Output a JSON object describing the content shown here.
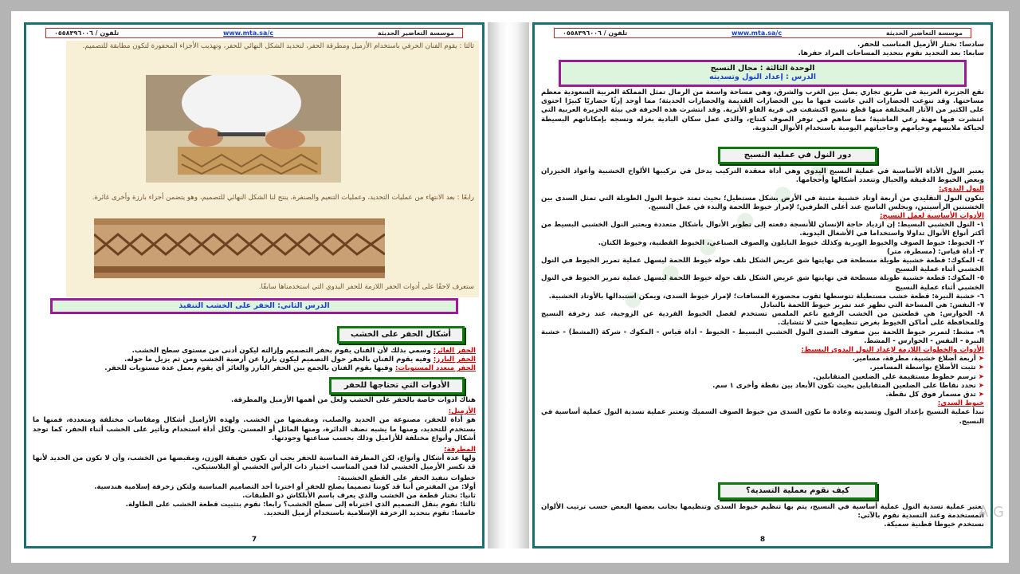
{
  "header": {
    "org": "موسسة التعاضير الحديثة",
    "url": "www.mta.sa/c",
    "phone": "تلفون / ٠٥٥٨٣٩٦٠٠٦"
  },
  "left_page": {
    "intro_1": "ثالثا : يقوم الفنان الحرفي باستخدام الأزميل ومطرقة الحفر، لتحديد الشكل النهائي للحفر، وتهذيب الأجزاء المحفورة لتكون مطابقة للتصميم.",
    "intro_2": "رابعًا : بعد الانتهاء من عمليات التحديد، وعمليات التنعيم والصنفرة، ينتج لنا الشكل النهائي للتصميم، وهو يتضمن أجزاء بارزة وأخرى غائرة.",
    "intro_3": "ستعرف لاحقًا على أدوات الحفر اللازمة للحفر اليدوي التي استخدمناها سابقًا.",
    "lesson_title": "الدرس الثاني: الحفر على الخشب التنفيذ",
    "shapes_title": "أشكال الحفر على الخشب",
    "shape_1_label": "الحفر الغائر:",
    "shape_1_text": "وسمي بذلك لأن الفنان يقوم بحفر التصميم وإزالته ليكون أدنى من مستوى سطح الخشب.",
    "shape_2_label": "الحفر البارز:",
    "shape_2_text": "وفيه يقوم الفنان بالحفر حول التصميم ليكون بارزا عن أرضية الخشب ومن ثم يزيل ما حوله.",
    "shape_3_label": "الحفر متعدد المستويات:",
    "shape_3_text": "وفيها يقوم الفنان بالجمع بين الحفر البارز والغائر أي يقوم بعمل عدة مستويات للحفر.",
    "tools_title": "الأدوات التي تحتاجها للحفر",
    "tools_intro": "هناك أدوات خاصة بالحفر على الخشب ولعل من أهمها الأزميل والمطرقة.",
    "chisel_label": "الأزميل:",
    "chisel_text": "هو أداة للحفر، مصنوعة من الحديد والصلب، ومقبضها من الخشب. ولهذه الأزاميل أشكال ومقاسات مختلفة ومتعددة، فمنها ما يستخدم للتحديد، ومنها ما يشبه نصف الدائرة، ومنها المائل أو المسنن. ولكل أداة استخدام وتأثير على الخشب أثناء الحفر، كما توجد أشكال وأنواع مختلفة للأزاميل وذلك بحسب صناعتها وجودتها.",
    "hammer_label": "المطرقة:",
    "hammer_text": "ولها عدة أشكال وأنواع، لكن المطرقة المناسبة للحفر يجب أن تكون خفيفة الوزن، ومقبضها من الخشب، وأن لا تكون من الحديد لأنها قد تكسر الأزميل الخشبي لذا فمن المناسب اختيار ذات الرأس الخشبي أو البلاستيكي.",
    "steps_title": "خطوات تنفيذ الحفر على القطع الخشبية:",
    "step_1": "أولا: من المفترض أننا قد كوننا تصميما يصلح للحفر أو اخترنا أحد التصاميم المناسبة ولتكن زخرفة إسلامية هندسية.",
    "step_2": "ثانيا: نختار قطعة من الخشب والذي يعرف باسم الأبلكاش ذو الطبقات.",
    "step_3": "ثالثا: نقوم بنقل التصميم الذي اخترناه إلى سطح الخشب؟ رابعا: نقوم بتثبيت قطعة الخشب على الطاولة.",
    "step_4": "خامسا: نقوم بتحديد الزخرفة الإسلامية باستخدام أزميل التحديد.",
    "page_number": "7"
  },
  "right_page": {
    "top_1": "سادسا: نختار الأزميل المناسب للحفر.",
    "top_2": "سابعا: بعد التحديد نقوم بتحديد المساحات المراد حفرها.",
    "unit_title": "الوحدة الثالثة : مجال النسيج",
    "lesson_title": "الدرس : إعداد النول وتسديته",
    "intro": "تقع الجزيرة العربية في طريق تجاري يصل بين الغرب والشرق، وهي مساحة واسعة من الرمال تمثل المملكة العربية السعودية معظم مساحتها. وقد تنوعت الحضارات التي عاشت فيها ما بين الحضارات القديمة والحضارات الحديثة؛ مما أوجد إرثًا حضاريًا كبيرًا احتوى على الكثير من الآثار المختلفة منها قطع نسيج اكتشفت في قرية الفاو الأثرية. وقد انتشرت هذه الحرفة في بيئة الجزيرة العربية التي انتشرت فيها مهنة رعي الماشية؛ مما ساهم في توفر الصوف كنتاج، والذي عمل سكان البادية بغزله ونسجه بإمكاناتهم البسيطة لحياكة ملابسهم وخيامهم وحاجياتهم اليومية باستخدام الأنوال البدوية.",
    "loom_role_title": "دور النول في عملية النسيج",
    "loom_role_text": "يعتبر النول الأداة الأساسية في عملية النسيج اليدوي وهي أداة معقدة التركيب يدخل في تركيبها الألواح الخشبية وأعواد الخيزران وبعض الخيوط الدقيقة والحبال وتتعدد أشكالها وأحجامها.",
    "bedouin_label": "النول البدوي:",
    "bedouin_text": "يتكون النول التقليدي من أربعة أوتاد خشبية مثبتة في الأرض بشكل مستطيل؛ بحيث تمتد خيوط النول الطويلة التي تمثل السدى بين الخشبتين الرأسيتين، ويجلس الناسج عند أعلى الطرفين؛ لإمرار خيوط اللحمة والبدء في عمل النسيج.",
    "basic_tools_label": "الأدوات الأساسية لعمل النسيج:",
    "tool_1": "١- النول الخشبي البسيط: إن ازدياد حاجة الإنسان للأنسجة دفعته إلى تطوير الأنوال بأشكال متعددة ويعتبر النول الخشبي البسيط من أكثر أنواع الأنوال تداولا واستخداما في الأشغال اليدوية.",
    "tool_2": "٢- الخيوط: خيوط الصوف والخيوط الوبرية وكذلك خيوط النايلون والصوف الصناعي، الخيوط القطنية، وخيوط الكتان.",
    "tool_3": "٣- أداة قياس: (مسطرة، متر)",
    "tool_4": "٤- المكوك: قطعة خشبية طويلة مسطحة في نهايتها شق عريض الشكل تلف حوله خيوط اللحمة ليسهل عملية تمرير الخيوط في النول الخشبي أثناء عملية النسيج",
    "tool_5": "٥- المكوك: قطعة خشبية طويلة مسطحة في نهايتها شق عريض الشكل تلف حوله خيوط اللحمة ليسهل عملية تمرير الخيوط في النول الخشبي أثناء عملية النسيج",
    "tool_6": "٦- خشبة النيرة: قطعة خشب مستطيلة تتوسطها ثقوب محصورة المسافات؛ لإمرار خيوط السدى، ويمكن استبدالها بالأوتاد الخشبية.",
    "tool_7": "٧- النفس: هي المساحة التي تظهر عند تمرير خيوط اللحمة بالتبادل",
    "tool_8": "٨- الحوارس: هي قطعتين من الخشب الرفيع ناعم الملمس تستخدم لفصل الخيوط الفردية عن الزوجية، عند زخرفة النسيج وللمحافظة على أماكن الخيوط بغرض تنظيمها حتى لا تتشابك.",
    "tool_9": "٩- مشط: لتمرير خيوط اللحمة بين صفوف السدى النول الخشبي البسيط - الخيوط - أداة قياس - المكوك - شركة (المشط) - خشبة النيرة - النفس - الحوارس - المشط.",
    "prep_label": "الأدوات والخطوات اللازمة لإعداد النول البدوي البسيط:",
    "prep_1": "أربعة أضلاع خشبية، مطرقة، مسامير.",
    "prep_2": "تثبت الأضلاع بواسطة المسامير.",
    "prep_3": "ترسم خطوط مستقيمة على الضلعين المتقابلين.",
    "prep_4": "تحدد نقاطا على الضلعين المتقابلين بحيث تكون الأبعاد بين نقطة وأخرى ١ سم.",
    "prep_5": "تدق مسمار فوق كل نقطة.",
    "warp_label": "خيوط السدى:",
    "warp_text": "تبدأ عملية النسيج بإعداد النول وتسديته وعادة ما تكون السدى من خيوط الصوف السميك وتعتبر عملية تسدية النول عملية أساسية في النسيج.",
    "how_title": "كيف نقوم بعملية التسدية؟",
    "how_text": "تعتبر عملية تسدية النول عملية أساسية في النسيج، يتم بها تنظيم خيوط السدى وتنظيمها بجانب بعضها البعض حسب ترتيب الألوان المستخدمة وعند التسدية نقوم بالآتي:",
    "how_last": "نستخدم خيوطا قطنية سميكة.",
    "page_number": "8"
  },
  "ghost_text": "A G"
}
